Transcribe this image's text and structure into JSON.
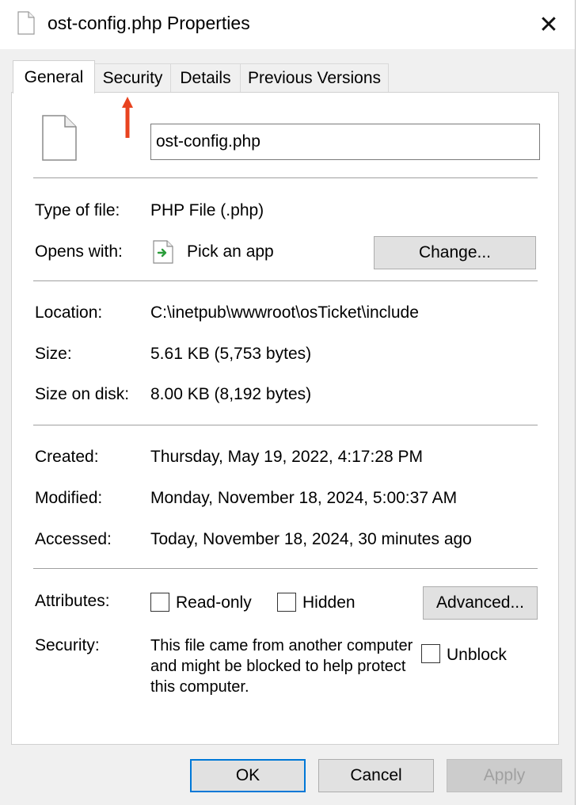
{
  "window": {
    "title": "ost-config.php Properties",
    "close_glyph": "✕"
  },
  "tabs": [
    {
      "label": "General",
      "active": true
    },
    {
      "label": "Security",
      "active": false
    },
    {
      "label": "Details",
      "active": false
    },
    {
      "label": "Previous Versions",
      "active": false
    }
  ],
  "file": {
    "name_value": "ost-config.php",
    "type_label": "Type of file:",
    "type_value": "PHP File (.php)",
    "opens_label": "Opens with:",
    "opens_value": "Pick an app",
    "change_button": "Change...",
    "location_label": "Location:",
    "location_value": "C:\\inetpub\\wwwroot\\osTicket\\include",
    "size_label": "Size:",
    "size_value": "5.61 KB (5,753 bytes)",
    "size_on_disk_label": "Size on disk:",
    "size_on_disk_value": "8.00 KB (8,192 bytes)",
    "created_label": "Created:",
    "created_value": "Thursday, May 19, 2022, 4:17:28 PM",
    "modified_label": "Modified:",
    "modified_value": "Monday, November 18, 2024, 5:00:37 AM",
    "accessed_label": "Accessed:",
    "accessed_value": "Today, November 18, 2024, 30 minutes ago"
  },
  "attributes": {
    "label": "Attributes:",
    "readonly_label": "Read-only",
    "readonly_checked": false,
    "hidden_label": "Hidden",
    "hidden_checked": false,
    "advanced_button": "Advanced..."
  },
  "security": {
    "label": "Security:",
    "message": "This file came from another computer and might be blocked to help protect this computer.",
    "unblock_label": "Unblock",
    "unblock_checked": false
  },
  "footer": {
    "ok": "OK",
    "cancel": "Cancel",
    "apply": "Apply"
  },
  "colors": {
    "accent_arrow": "#e8431f",
    "focus_border": "#0078d7",
    "app_icon_green": "#2a9d3a"
  },
  "icons": {
    "title": "file-icon",
    "large": "file-icon",
    "opens_with": "app-picker-icon",
    "annotation": "red-arrow-up"
  }
}
